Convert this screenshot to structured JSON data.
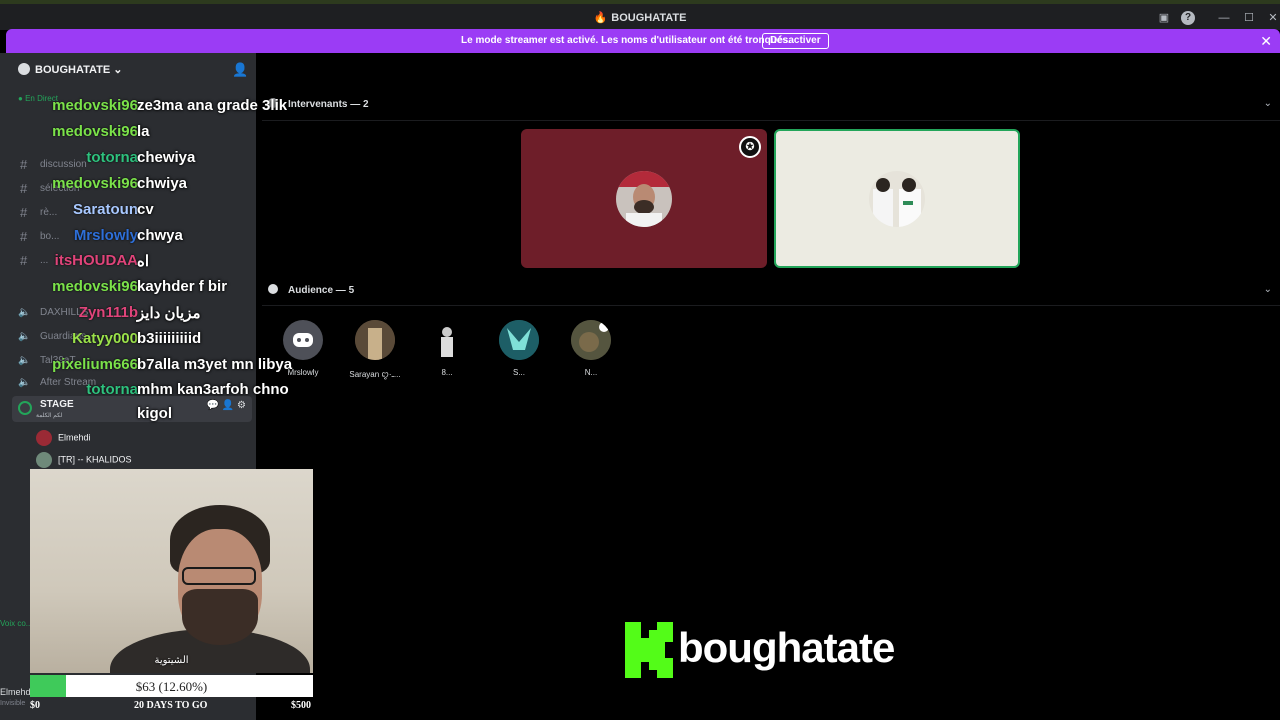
{
  "window": {
    "title": "BOUGHATATE"
  },
  "banner": {
    "message": "Le mode streamer est activé. Les noms d'utilisateur ont été tronqués.",
    "button": "Désactiver"
  },
  "sidebar": {
    "server_name": "BOUGHATATE",
    "live_label": "En Direct",
    "channels": [
      {
        "label": "discussion"
      },
      {
        "label": "sélection"
      },
      {
        "label": "rè..."
      },
      {
        "label": "bo..."
      },
      {
        "label": "..."
      }
    ],
    "voice": [
      {
        "label": "DAXHILLS"
      },
      {
        "label": "Guardians"
      },
      {
        "label": "Tal39aT"
      },
      {
        "label": "After Stream"
      }
    ],
    "stage": {
      "name": "STAGE",
      "subtitle": "لكم الكلمة"
    },
    "stage_members": [
      {
        "name": "Elmehdi"
      },
      {
        "name": "[TR] -- KHALIDOS"
      }
    ],
    "footer_user": "Elmehdi",
    "footer_status": "Invisible",
    "voice_connected": "Voix co..."
  },
  "chat": [
    {
      "user": "medovski96",
      "color": "#7be24a",
      "message": "ze3ma ana grade 3lik"
    },
    {
      "user": "medovski96",
      "color": "#7be24a",
      "message": "la"
    },
    {
      "user": "totorna",
      "color": "#2ec27e",
      "message": "chewiya"
    },
    {
      "user": "medovski96",
      "color": "#7be24a",
      "message": "chwiya"
    },
    {
      "user": "Saratoun",
      "color": "#a8c8ff",
      "message": "cv"
    },
    {
      "user": "Mrslowly",
      "color": "#2e6fd8",
      "message": "chwya"
    },
    {
      "user": "itsHOUDAA",
      "color": "#e0447a",
      "message": "اه"
    },
    {
      "user": "medovski96",
      "color": "#7be24a",
      "message": "kayhder f bir"
    },
    {
      "user": "Zyn111b",
      "color": "#e0447a",
      "message": "مزيان دايز"
    },
    {
      "user": "Katyy000",
      "color": "#9be24a",
      "message": "b3iiiiiiiiid"
    },
    {
      "user": "pixelium666",
      "color": "#7be24a",
      "message": "b7alla m3yet mn libya"
    },
    {
      "user": "totorna",
      "color": "#2ec27e",
      "message": "mhm kan3arfoh chno"
    },
    {
      "user": "",
      "color": "#2ec27e",
      "message": "kigol"
    }
  ],
  "stage": {
    "speakers_heading": "Intervenants — 2",
    "audience_heading": "Audience — 5",
    "audience": [
      {
        "name": "Mrslowly"
      },
      {
        "name": "Sarayan ꨄ·ـ..."
      },
      {
        "name": "8..."
      },
      {
        "name": "S..."
      },
      {
        "name": "N..."
      }
    ]
  },
  "webcam": {
    "caption": "الشيتوية"
  },
  "goal": {
    "text": "$63 (12.60%)",
    "progress": 12.6,
    "start": "$0",
    "countdown": "20 DAYS TO GO",
    "target": "$500"
  },
  "brand": {
    "name": "boughatate",
    "accent": "#53fc18"
  }
}
